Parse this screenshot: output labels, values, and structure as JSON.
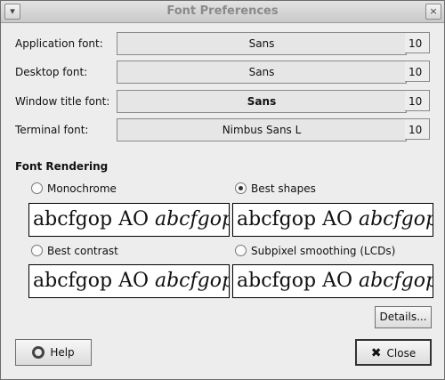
{
  "window": {
    "title": "Font Preferences"
  },
  "fonts": [
    {
      "label": "Application font:",
      "value": "Sans",
      "size": "10",
      "bold": false
    },
    {
      "label": "Desktop font:",
      "value": "Sans",
      "size": "10",
      "bold": false
    },
    {
      "label": "Window title font:",
      "value": "Sans",
      "size": "10",
      "bold": true
    },
    {
      "label": "Terminal font:",
      "value": "Nimbus Sans L",
      "size": "10",
      "bold": false
    }
  ],
  "rendering": {
    "title": "Font Rendering",
    "options": [
      {
        "label": "Monochrome",
        "selected": false
      },
      {
        "label": "Best shapes",
        "selected": true
      },
      {
        "label": "Best contrast",
        "selected": false
      },
      {
        "label": "Subpixel smoothing (LCDs)",
        "selected": false
      }
    ],
    "sample_regular": "abcfgop AO ",
    "sample_italic": "abcfgop"
  },
  "buttons": {
    "details": "Details...",
    "help": "Help",
    "close": "Close"
  },
  "icons": {
    "help": "lifebuoy-icon",
    "close": "x-icon"
  }
}
